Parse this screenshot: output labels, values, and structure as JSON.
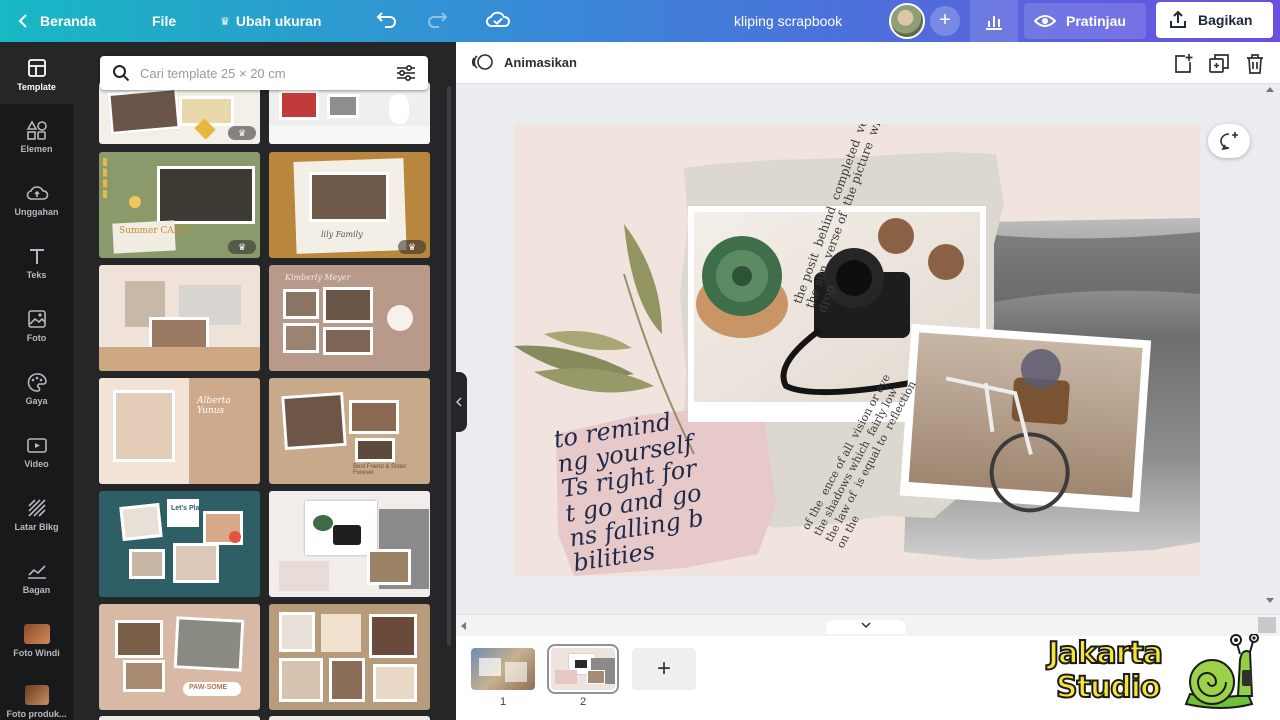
{
  "topbar": {
    "back_label": "Beranda",
    "file_label": "File",
    "resize_label": "Ubah ukuran",
    "doc_title": "kliping scrapbook",
    "preview_label": "Pratinjau",
    "share_label": "Bagikan"
  },
  "rail": {
    "items": [
      {
        "label": "Template",
        "icon": "template-icon",
        "active": true
      },
      {
        "label": "Elemen",
        "icon": "elements-icon"
      },
      {
        "label": "Unggahan",
        "icon": "upload-icon"
      },
      {
        "label": "Teks",
        "icon": "text-icon"
      },
      {
        "label": "Foto",
        "icon": "photo-icon"
      },
      {
        "label": "Gaya",
        "icon": "styles-icon"
      },
      {
        "label": "Video",
        "icon": "video-icon"
      },
      {
        "label": "Latar Blkg",
        "icon": "background-icon"
      },
      {
        "label": "Bagan",
        "icon": "chart-icon"
      },
      {
        "label": "Foto Windi",
        "icon": "folder-photo-icon"
      },
      {
        "label": "Foto produk...",
        "icon": "folder-photo-icon"
      }
    ]
  },
  "panel": {
    "search_placeholder": "Cari template 25 × 20 cm",
    "templates": [
      {
        "text": "",
        "bg": "#f3efe9",
        "premium": true
      },
      {
        "text": "",
        "bg": "#efefef"
      },
      {
        "text": "Summer CAMP",
        "bg": "#8a9a6a",
        "premium": true
      },
      {
        "text": "lily Family",
        "bg": "#b8863c",
        "premium": true
      },
      {
        "text": "",
        "bg": "#efe3d9"
      },
      {
        "text": "Kimberly Meyer",
        "bg": "#b79a8a"
      },
      {
        "text": "Alberta Yunus",
        "bg": "#cfa98c"
      },
      {
        "text": "Best Friend & Sister Forever",
        "bg": "#c8a98a"
      },
      {
        "text": "Let's Play!",
        "bg": "#2f5f66"
      },
      {
        "text": "",
        "bg": "#f2ecea"
      },
      {
        "text": "PAW-SOME",
        "bg": "#d8b9a6"
      },
      {
        "text": "",
        "bg": "#b89b7a"
      }
    ]
  },
  "editor": {
    "animate_label": "Animasikan"
  },
  "canvas": {
    "handwriting": [
      "to remind",
      "ng yourself",
      "Ts right for",
      "t go and go",
      "ns falling b",
      "bilities"
    ],
    "newspaper": [
      "the posit",
      "behind",
      "completed",
      "vertically",
      "the sun",
      "verse of",
      "the picture",
      "where the",
      "drop",
      "of the",
      "ence of all",
      "vision or eye",
      "the shadows which",
      "fairly low",
      "the law of",
      "is equal to",
      "reflection",
      "on the"
    ]
  },
  "pages": {
    "items": [
      {
        "num": "1"
      },
      {
        "num": "2",
        "selected": true
      }
    ],
    "add_label": "+"
  },
  "watermark": {
    "line1": "Jakarta",
    "line2": "Studio"
  },
  "colors": {
    "topbar_start": "#18b8c4",
    "topbar_end": "#6a4fe0",
    "rail_bg": "#18191b",
    "panel_bg": "#252627",
    "canvas_bg": "#f1e4df"
  }
}
